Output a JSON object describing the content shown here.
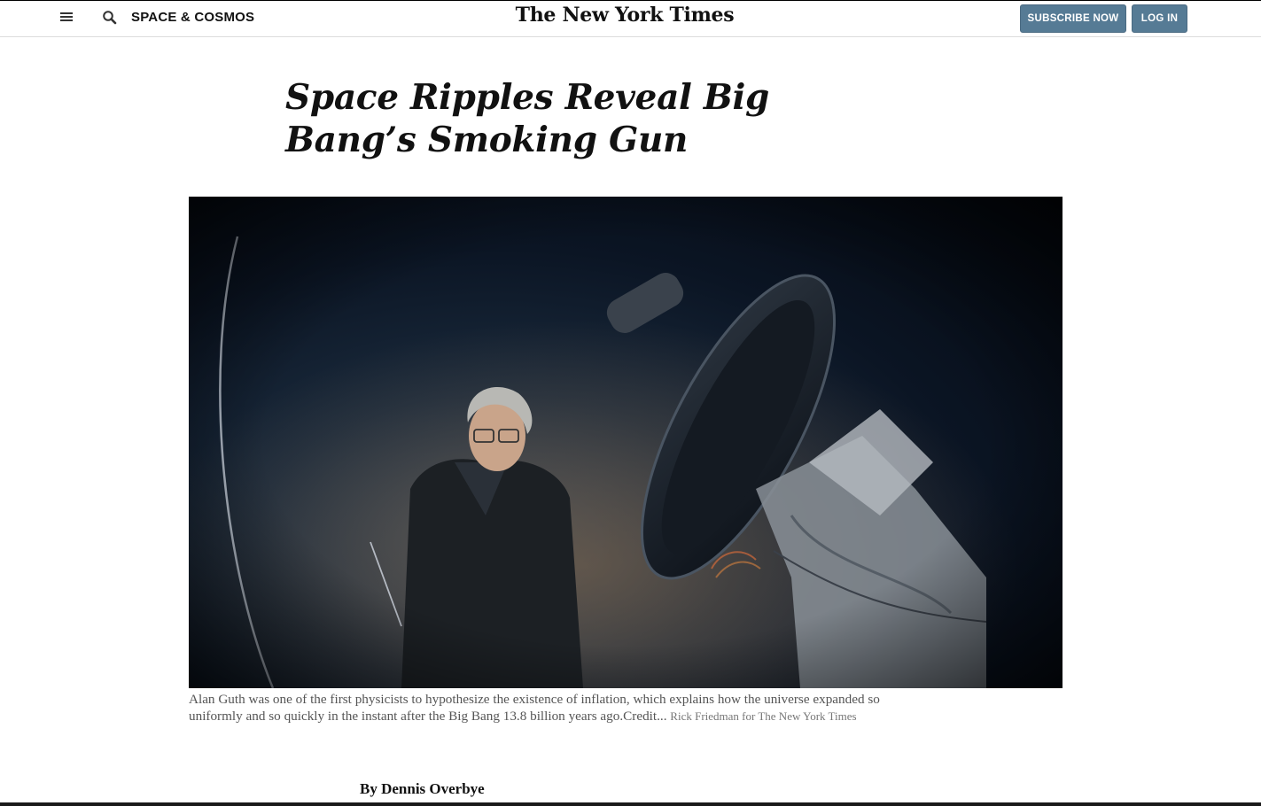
{
  "header": {
    "section": "SPACE & COSMOS",
    "logo": "The New York Times",
    "subscribe_label": "SUBSCRIBE NOW",
    "login_label": "LOG IN",
    "icons": {
      "menu": "hamburger-menu-icon",
      "search": "search-icon"
    }
  },
  "article": {
    "headline": "Space Ripples Reveal Big Bang’s Smoking Gun",
    "image": {
      "subject": "person-with-telescope-photo"
    },
    "caption": "Alan Guth was one of the first physicists to hypothesize the existence of inflation, which explains how the universe expanded so uniformly and so quickly in the instant after the Big Bang 13.8 billion years ago.",
    "credit_prefix": "Credit...",
    "credit": "Rick Friedman for The New York Times",
    "byline": "By Dennis Overbye"
  },
  "colors": {
    "button_bg": "#567b95",
    "text": "#121212",
    "caption": "#555555"
  }
}
